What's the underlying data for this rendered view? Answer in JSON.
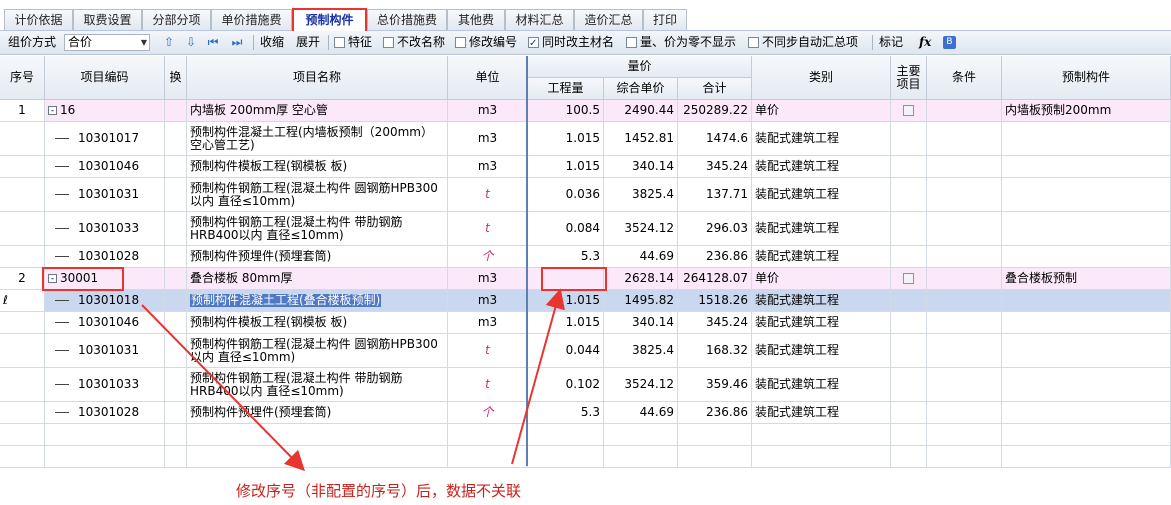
{
  "tabs": [
    "计价依据",
    "取费设置",
    "分部分项",
    "单价措施费",
    "预制构件",
    "总价措施费",
    "其他费",
    "材料汇总",
    "造价汇总",
    "打印"
  ],
  "toolbar": {
    "group_label": "组价方式",
    "group_value": "合价",
    "collapse": "收缩",
    "expand": "展开",
    "checks": [
      {
        "label": "特征",
        "checked": false
      },
      {
        "label": "不改名称",
        "checked": false
      },
      {
        "label": "修改编号",
        "checked": false
      },
      {
        "label": "同时改主材名",
        "checked": true
      },
      {
        "label": "量、价为零不显示",
        "checked": false
      },
      {
        "label": "不同步自动汇总项",
        "checked": false
      }
    ],
    "mark": "标记",
    "fx": "fx"
  },
  "headers": {
    "seq": "序号",
    "code": "项目编码",
    "swap": "换",
    "name": "项目名称",
    "unit": "单位",
    "qp": "量价",
    "qty": "工程量",
    "uprice": "综合单价",
    "total": "合计",
    "category": "类别",
    "main": "主要项目",
    "cond": "条件",
    "prefab": "预制构件"
  },
  "rows": [
    {
      "seq": "1",
      "code": "16",
      "name": "内墙板 200mm厚 空心管",
      "unit": "m3",
      "qty": "100.5",
      "uprice": "2490.44",
      "total": "250289.22",
      "category": "单价",
      "prefab": "内墙板预制200mm",
      "type": "parent"
    },
    {
      "seq": "",
      "code": "10301017",
      "name": "预制构件混凝土工程(内墙板预制（200mm）空心管工艺)",
      "unit": "m3",
      "qty": "1.015",
      "uprice": "1452.81",
      "total": "1474.6",
      "category": "装配式建筑工程",
      "prefab": "",
      "type": "child"
    },
    {
      "seq": "",
      "code": "10301046",
      "name": "预制构件模板工程(钢模板 板)",
      "unit": "m3",
      "qty": "1.015",
      "uprice": "340.14",
      "total": "345.24",
      "category": "装配式建筑工程",
      "prefab": "",
      "type": "child"
    },
    {
      "seq": "",
      "code": "10301031",
      "name": "预制构件钢筋工程(混凝土构件 圆钢筋HPB300以内 直径≤10mm)",
      "unit": "t",
      "qty": "0.036",
      "uprice": "3825.4",
      "total": "137.71",
      "category": "装配式建筑工程",
      "prefab": "",
      "type": "child"
    },
    {
      "seq": "",
      "code": "10301033",
      "name": "预制构件钢筋工程(混凝土构件 带肋钢筋HRB400以内 直径≤10mm)",
      "unit": "t",
      "qty": "0.084",
      "uprice": "3524.12",
      "total": "296.03",
      "category": "装配式建筑工程",
      "prefab": "",
      "type": "child"
    },
    {
      "seq": "",
      "code": "10301028",
      "name": "预制构件预埋件(预埋套筒)",
      "unit": "个",
      "qty": "5.3",
      "uprice": "44.69",
      "total": "236.86",
      "category": "装配式建筑工程",
      "prefab": "",
      "type": "child"
    },
    {
      "seq": "2",
      "code": "30001",
      "name": "叠合楼板 80mm厚",
      "unit": "m3",
      "qty": "",
      "uprice": "2628.14",
      "total": "264128.07",
      "category": "单价",
      "prefab": "叠合楼板预制",
      "type": "parent"
    },
    {
      "seq": "",
      "code": "10301018",
      "name": "预制构件混凝土工程(叠合楼板预制)",
      "unit": "m3",
      "qty": "1.015",
      "uprice": "1495.82",
      "total": "1518.26",
      "category": "装配式建筑工程",
      "prefab": "",
      "type": "selected"
    },
    {
      "seq": "",
      "code": "10301046",
      "name": "预制构件模板工程(钢模板 板)",
      "unit": "m3",
      "qty": "1.015",
      "uprice": "340.14",
      "total": "345.24",
      "category": "装配式建筑工程",
      "prefab": "",
      "type": "child"
    },
    {
      "seq": "",
      "code": "10301031",
      "name": "预制构件钢筋工程(混凝土构件 圆钢筋HPB300以内 直径≤10mm)",
      "unit": "t",
      "qty": "0.044",
      "uprice": "3825.4",
      "total": "168.32",
      "category": "装配式建筑工程",
      "prefab": "",
      "type": "child"
    },
    {
      "seq": "",
      "code": "10301033",
      "name": "预制构件钢筋工程(混凝土构件 带肋钢筋HRB400以内 直径≤10mm)",
      "unit": "t",
      "qty": "0.102",
      "uprice": "3524.12",
      "total": "359.46",
      "category": "装配式建筑工程",
      "prefab": "",
      "type": "child"
    },
    {
      "seq": "",
      "code": "10301028",
      "name": "预制构件预埋件(预埋套筒)",
      "unit": "个",
      "qty": "5.3",
      "uprice": "44.69",
      "total": "236.86",
      "category": "装配式建筑工程",
      "prefab": "",
      "type": "child"
    }
  ],
  "annotation": "修改序号（非配置的序号）后，数据不关联",
  "colors": {
    "accent_red": "#e8352f",
    "parent_row": "#fbe8f8",
    "selected_row": "#c9d8ef"
  }
}
